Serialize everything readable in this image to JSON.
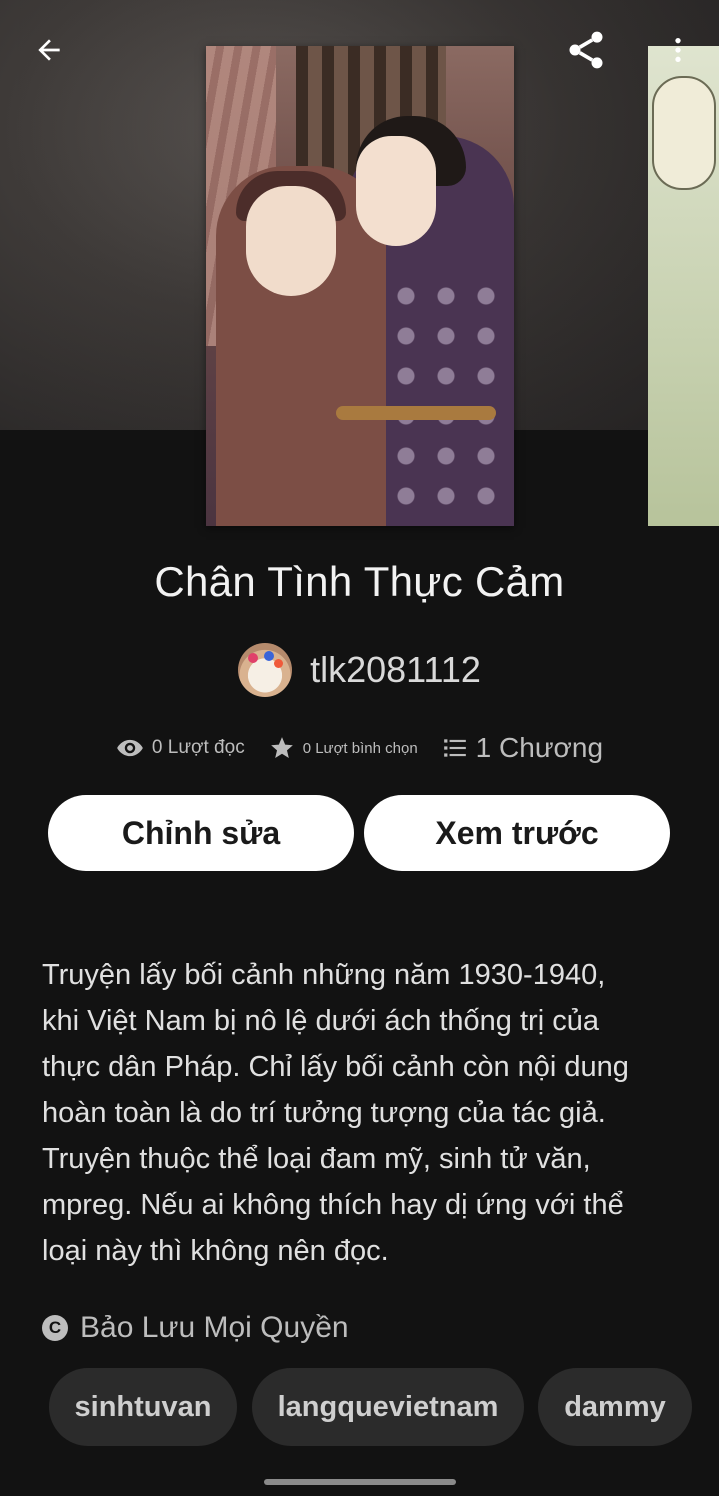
{
  "topbar": {
    "back_icon": "arrow-left-icon",
    "share_icon": "share-icon",
    "more_icon": "more-vertical-icon"
  },
  "story": {
    "title": "Chân Tình Thực Cảm",
    "author": "tlk2081112",
    "stats": {
      "reads": "0 Lượt đọc",
      "votes": "0 Lượt bình chọn",
      "chapters": "1 Chương"
    },
    "actions": {
      "edit_label": "Chỉnh sửa",
      "preview_label": "Xem trước"
    },
    "description": "Truyện lấy bối cảnh những năm 1930-1940,\nkhi Việt Nam bị nô lệ dưới ách thống trị của\nthực dân Pháp. Chỉ lấy bối cảnh còn nội dung\nhoàn toàn là do trí tưởng tượng của tác giả.\nTruyện thuộc thể loại đam mỹ, sinh tử văn,\nmpreg. Nếu ai không thích hay dị ứng với thể\nloại này thì không nên đọc.",
    "copyright": "Bảo Lưu Mọi Quyền",
    "tags": [
      "sinhtuvan",
      "langquevietnam",
      "dammy"
    ]
  },
  "colors": {
    "background": "#121212",
    "button_bg": "#ffffff",
    "tag_bg": "#2b2b2b"
  }
}
